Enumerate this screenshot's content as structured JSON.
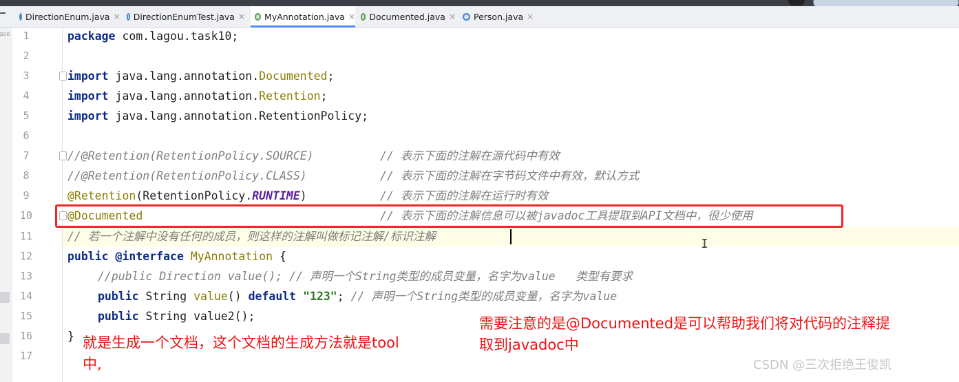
{
  "tabs": [
    {
      "name": "DirectionEnum.java",
      "icon": "enum-icon",
      "active": false
    },
    {
      "name": "DirectionEnumTest.java",
      "icon": "class-icon",
      "active": false
    },
    {
      "name": "MyAnnotation.java",
      "icon": "annotation-icon",
      "active": true
    },
    {
      "name": "Documented.java",
      "icon": "annotation-icon",
      "active": false
    },
    {
      "name": "Person.java",
      "icon": "class-icon",
      "active": false
    }
  ],
  "tab_close_glyph": "×",
  "left_strip_label": "ase",
  "line_numbers": [
    "1",
    "2",
    "3",
    "4",
    "5",
    "6",
    "7",
    "8",
    "9",
    "10",
    "11",
    "12",
    "13",
    "14",
    "15",
    "16",
    "17"
  ],
  "code": {
    "l1_kw": "package",
    "l1_rest": " com.lagou.task10;",
    "l3_kw": "import",
    "l3_pkg": " java.lang.annotation.",
    "l3_cls": "Documented",
    "l3_end": ";",
    "l4_kw": "import",
    "l4_pkg": " java.lang.annotation.",
    "l4_cls": "Retention",
    "l4_end": ";",
    "l5_kw": "import",
    "l5_rest": " java.lang.annotation.RetentionPolicy;",
    "l7_code": "//@Retention(RetentionPolicy.SOURCE)",
    "l7_cmt": "// 表示下面的注解在源代码中有效",
    "l8_code": "//@Retention(RetentionPolicy.CLASS)",
    "l8_cmt": "// 表示下面的注解在字节码文件中有效，默认方式",
    "l9_anno": "@Retention",
    "l9_paren": "(RetentionPolicy.",
    "l9_const": "RUNTIME",
    "l9_close": ")",
    "l9_cmt": "// 表示下面的注解在运行时有效",
    "l10_anno": "@Documented",
    "l10_cmt": "// 表示下面的注解信息可以被javadoc工具提取到API文档中，很少使用",
    "l11_cmt": "// 若一个注解中没有任何的成员，则这样的注解叫做标记注解/标识注解",
    "l12_kw": "public @interface",
    "l12_name": " MyAnnotation",
    "l12_brace": " {",
    "l13_cmt": "//public Direction value(); // 声明一个String类型的成员变量，名字为value   类型有要求",
    "l14_kw": "public",
    "l14_mid": " String ",
    "l14_m": "value",
    "l14_par": "() ",
    "l14_kw2": "default",
    "l14_sp": " ",
    "l14_str": "\"123\"",
    "l14_semi": ";",
    "l14_cmt": " // 声明一个String类型的成员变量，名字为value",
    "l15_kw": "public",
    "l15_rest": " String value2();",
    "l16_brace": "}"
  },
  "notes": {
    "left": "就是生成一个文档，这个文档的生成方法就是tool\n中,",
    "right": "需要注意的是@Documented是可以帮助我们将对代码的注释提\n取到javadoc中"
  },
  "caret_glyph": "I",
  "watermark": "CSDN @三次拒绝王俊凯",
  "colors": {
    "keyword": "#0b2b86",
    "annotation": "#8b7d00",
    "comment": "#7f7f7f",
    "string": "#2a7a1e",
    "constant": "#5a1f9a",
    "highlight_box": "#ee2626",
    "note_text": "#ee1111"
  }
}
